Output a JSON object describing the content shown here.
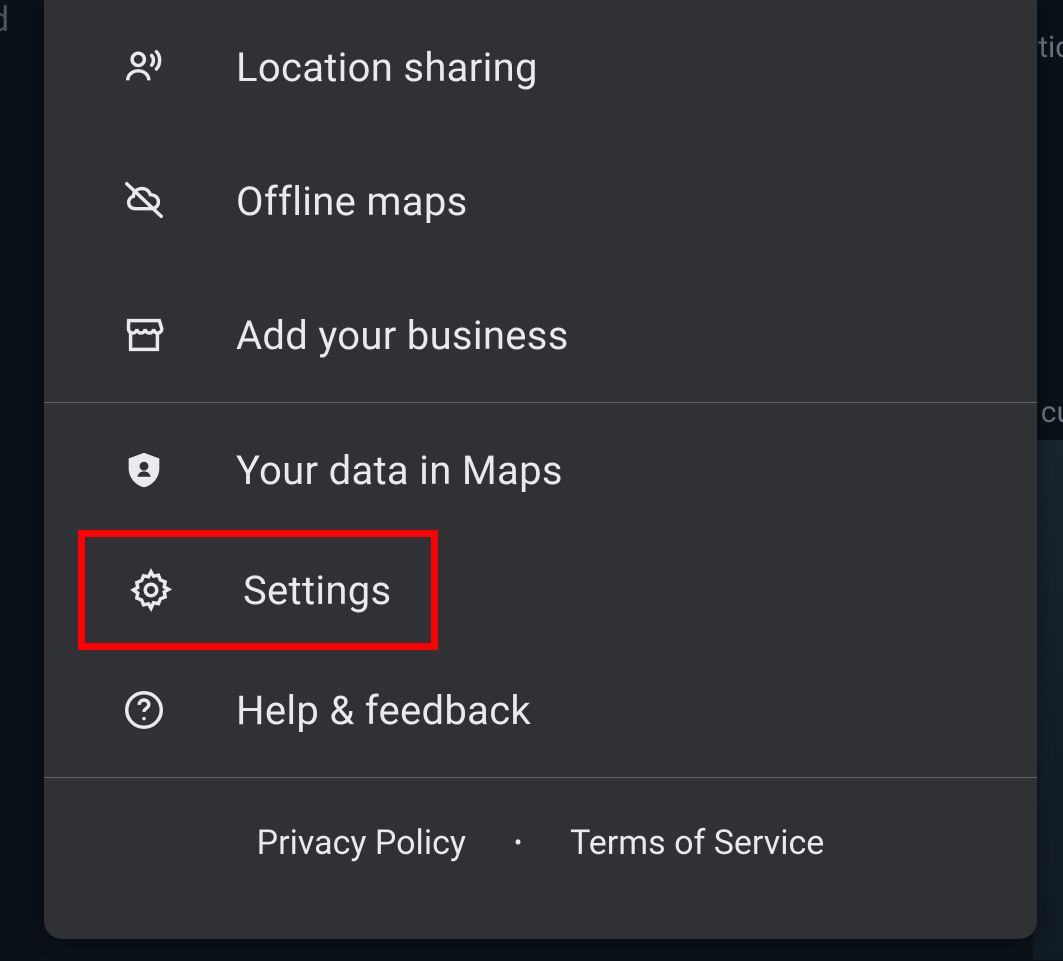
{
  "menu": {
    "sections": [
      {
        "items": [
          {
            "id": "location-sharing",
            "label": "Location sharing",
            "icon": "location-sharing-icon"
          },
          {
            "id": "offline-maps",
            "label": "Offline maps",
            "icon": "offline-maps-icon"
          },
          {
            "id": "add-business",
            "label": "Add your business",
            "icon": "storefront-icon"
          }
        ]
      },
      {
        "items": [
          {
            "id": "your-data",
            "label": "Your data in Maps",
            "icon": "shield-account-icon"
          },
          {
            "id": "settings",
            "label": "Settings",
            "icon": "gear-icon",
            "highlighted": true
          },
          {
            "id": "help",
            "label": "Help & feedback",
            "icon": "help-icon"
          }
        ]
      }
    ]
  },
  "footer": {
    "privacy": "Privacy Policy",
    "terms": "Terms of Service"
  }
}
